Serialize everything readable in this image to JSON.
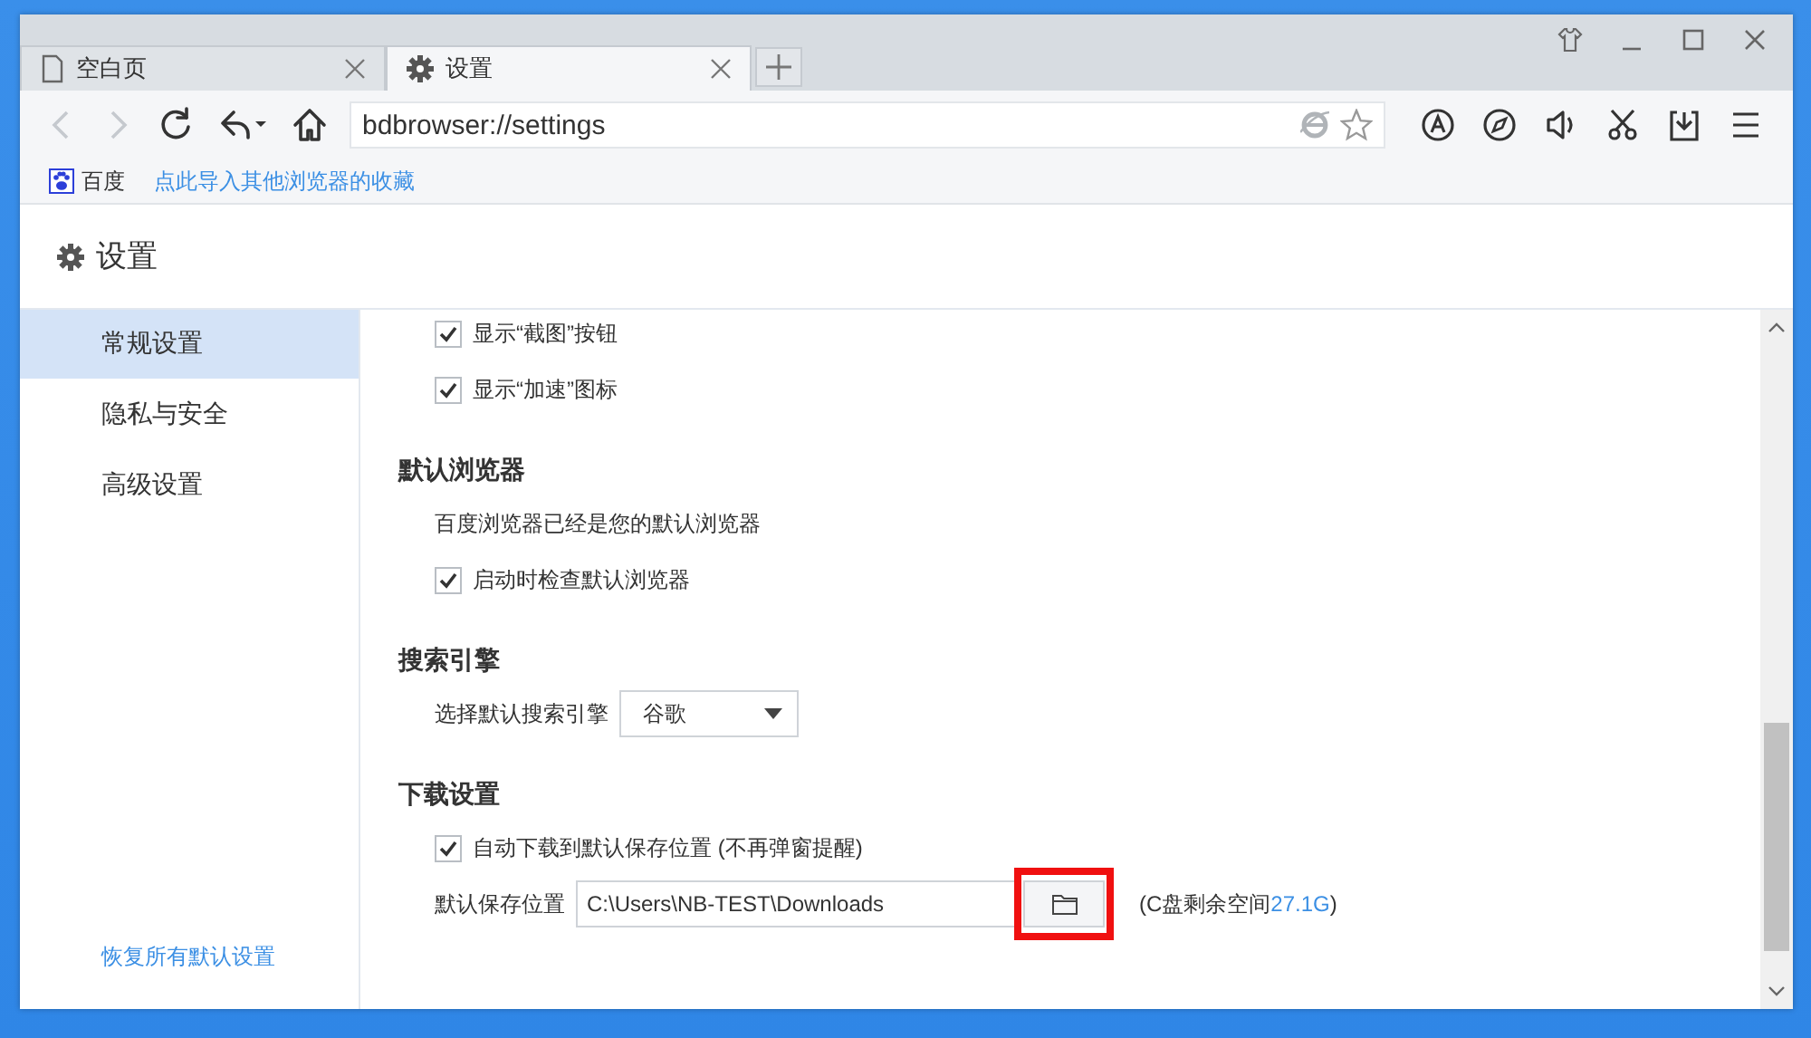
{
  "tabs": [
    {
      "label": "空白页",
      "kind": "blank",
      "selected": false
    },
    {
      "label": "设置",
      "kind": "settings",
      "selected": true
    }
  ],
  "nav": {
    "back_disabled": true,
    "forward_disabled": true
  },
  "address_bar": {
    "value": "bdbrowser://settings"
  },
  "bookmarks": [
    {
      "label": "百度",
      "kind": "site"
    },
    {
      "label": "点此导入其他浏览器的收藏",
      "kind": "link"
    }
  ],
  "page": {
    "title": "设置"
  },
  "sidebar": {
    "items": [
      {
        "label": "常规设置",
        "selected": true
      },
      {
        "label": "隐私与安全",
        "selected": false
      },
      {
        "label": "高级设置",
        "selected": false
      }
    ],
    "footer_link": "恢复所有默认设置"
  },
  "sections": [
    {
      "rows": [
        {
          "kind": "checkbox",
          "label": "显示“截图”按钮",
          "checked": true
        },
        {
          "kind": "checkbox",
          "label": "显示“加速”图标",
          "checked": true
        }
      ]
    },
    {
      "heading": "默认浏览器",
      "rows": [
        {
          "kind": "note",
          "label": "百度浏览器已经是您的默认浏览器"
        },
        {
          "kind": "checkbox",
          "label": "启动时检查默认浏览器",
          "checked": true
        }
      ]
    },
    {
      "heading": "搜索引擎",
      "rows": [
        {
          "kind": "select",
          "label": "选择默认搜索引擎",
          "value": "谷歌"
        }
      ]
    },
    {
      "heading": "下载设置",
      "rows": [
        {
          "kind": "checkbox",
          "label": "自动下载到默认保存位置 (不再弹窗提醒)",
          "checked": true
        },
        {
          "kind": "path",
          "label": "默认保存位置",
          "value": "C:\\Users\\NB-TEST\\Downloads",
          "highlighted": true,
          "note_prefix": "(C盘剩余空间",
          "note_amount": "27.1G",
          "note_suffix": ")"
        }
      ]
    }
  ]
}
